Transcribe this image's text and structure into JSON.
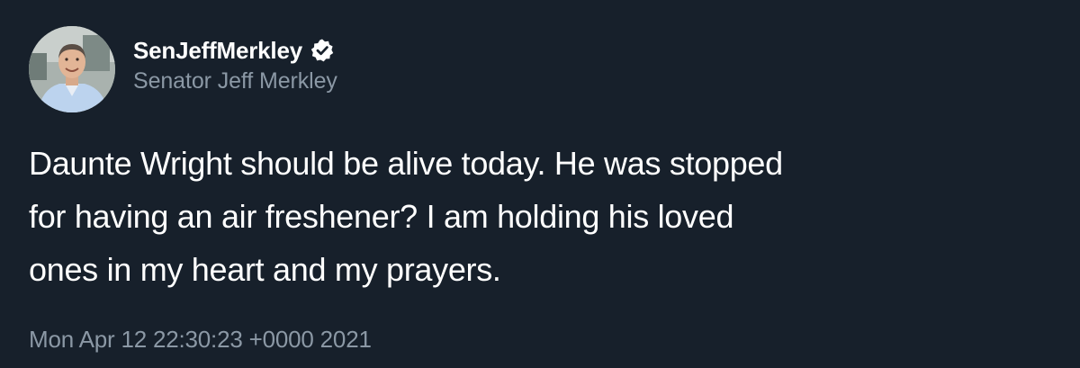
{
  "tweet": {
    "display_name": "SenJeffMerkley",
    "handle": "Senator Jeff Merkley",
    "text": "Daunte Wright should be alive today. He was stopped\nfor having an air freshener?   I am holding his loved\nones in my heart and my prayers.",
    "timestamp": "Mon Apr 12 22:30:23 +0000 2021",
    "verified_icon": "verified-badge-icon",
    "avatar_icon": "profile-photo"
  },
  "colors": {
    "background": "#17202b",
    "primary_text": "#ffffff",
    "secondary_text": "#8b98a5"
  }
}
